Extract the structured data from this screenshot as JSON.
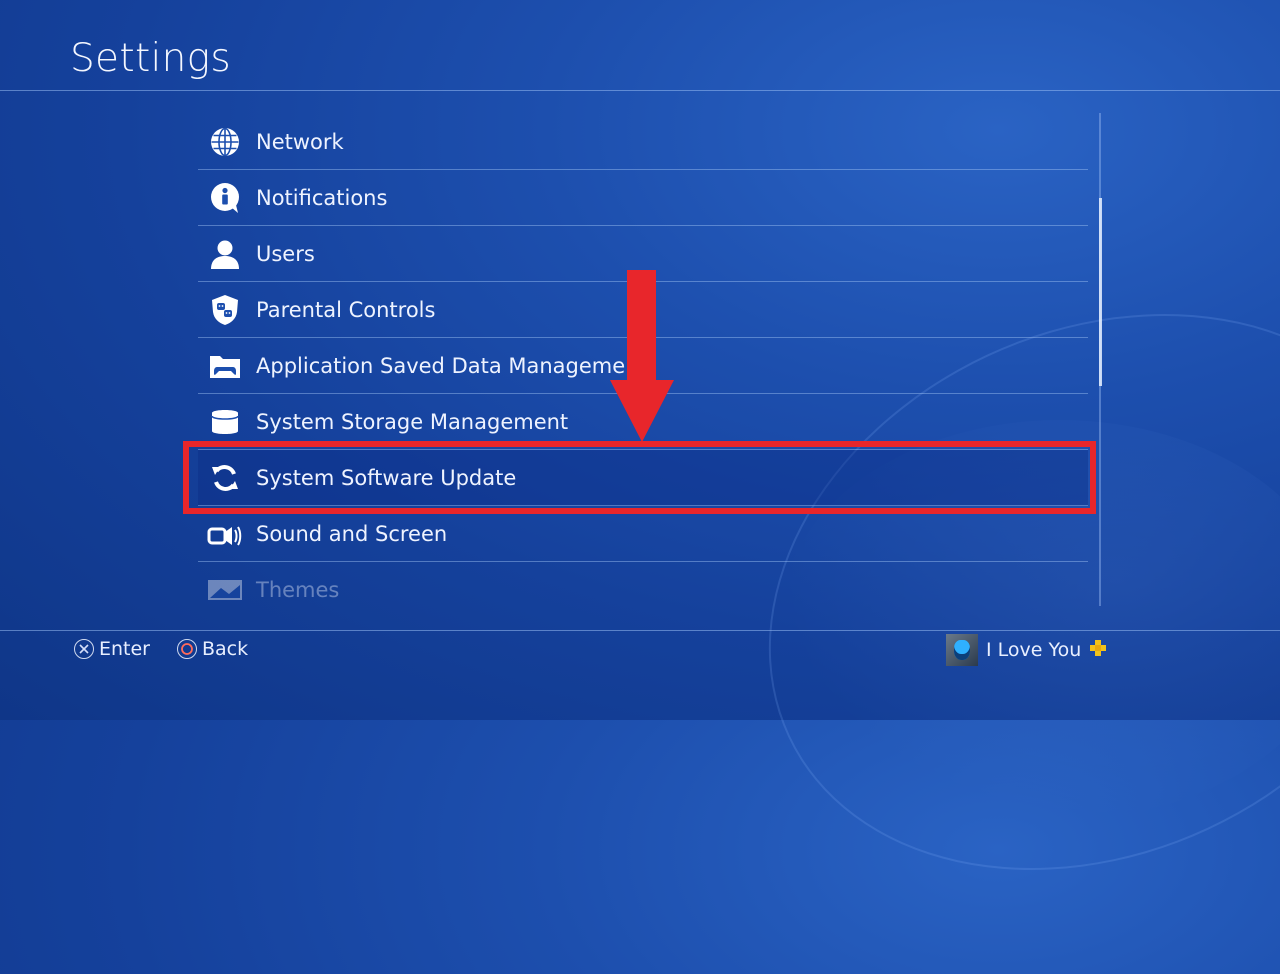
{
  "header": {
    "title": "Settings"
  },
  "menu": {
    "items": [
      {
        "label": "Network",
        "icon": "globe-icon"
      },
      {
        "label": "Notifications",
        "icon": "info-bubble-icon"
      },
      {
        "label": "Users",
        "icon": "user-icon"
      },
      {
        "label": "Parental Controls",
        "icon": "parental-controls-icon"
      },
      {
        "label": "Application Saved Data Management",
        "icon": "saved-data-icon"
      },
      {
        "label": "System Storage Management",
        "icon": "storage-icon"
      },
      {
        "label": "System Software Update",
        "icon": "update-icon",
        "selected": true
      },
      {
        "label": "Sound and Screen",
        "icon": "sound-screen-icon"
      },
      {
        "label": "Themes",
        "icon": "themes-icon"
      }
    ]
  },
  "footer": {
    "enter_label": "Enter",
    "back_label": "Back",
    "user_name": "I Love You"
  },
  "colors": {
    "highlight": "#e8262b",
    "background": "#1a4aa8",
    "plus_badge": "#f2c21a"
  }
}
